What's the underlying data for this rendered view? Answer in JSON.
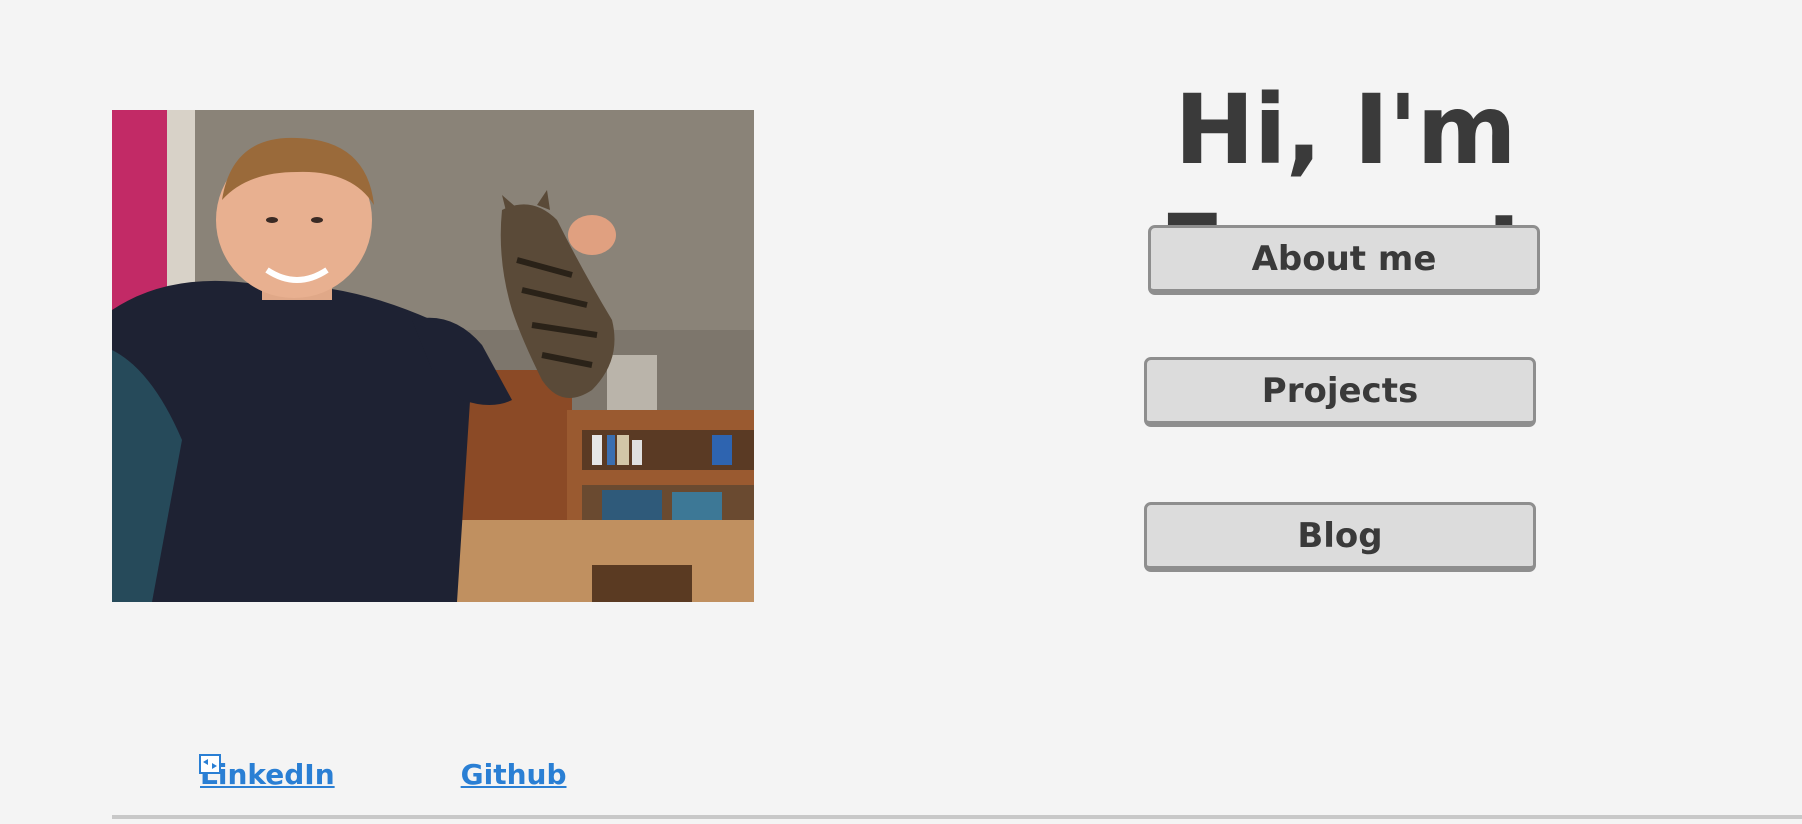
{
  "photo": {
    "alt": "Emmet holding a cat"
  },
  "heading": {
    "title": "Hi, I'm Emmet"
  },
  "nav": {
    "about_label": "About me",
    "projects_label": "Projects",
    "blog_label": "Blog"
  },
  "footer": {
    "linkedin_label": "LinkedIn",
    "github_label": "Github"
  },
  "colors": {
    "background": "#f4f4f4",
    "text": "#3a3a3a",
    "button_fill": "#dcdcdc",
    "button_border": "#8e8e8e",
    "link": "#2a7fd4"
  },
  "icons": {
    "linkedin_icon": "broken-image-icon"
  }
}
